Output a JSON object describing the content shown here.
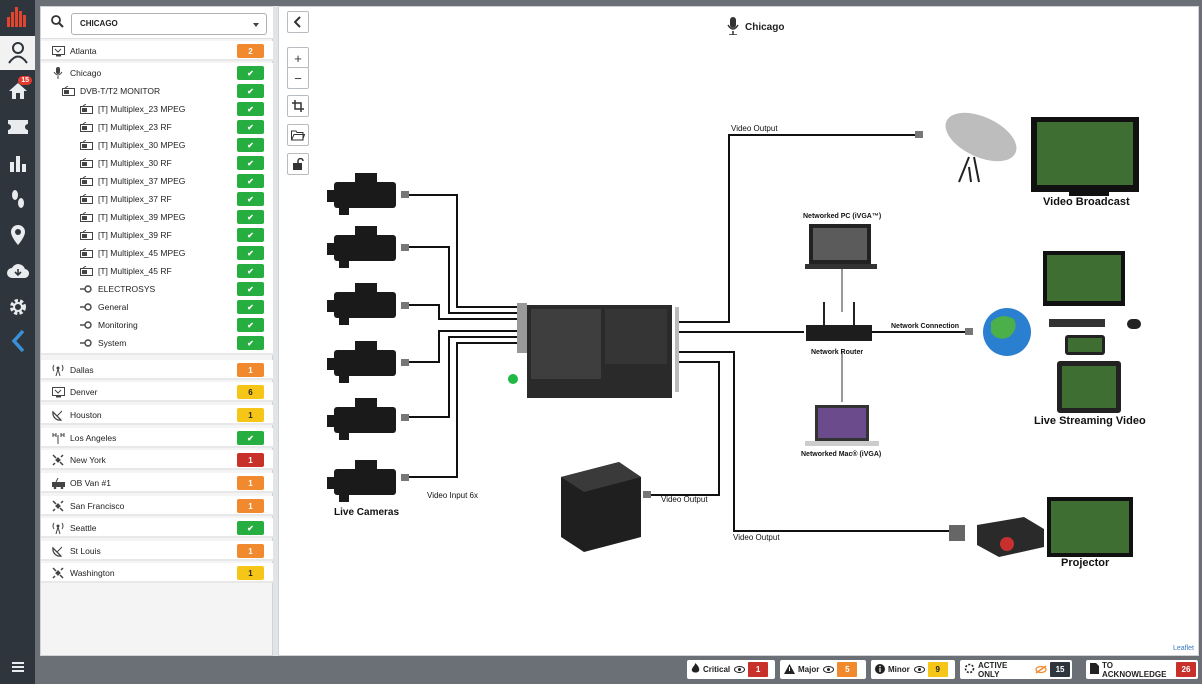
{
  "nav": {
    "home_badge": "15"
  },
  "search": {
    "selected": "CHICAGO"
  },
  "sites": [
    {
      "name": "Atlanta",
      "badge": "2",
      "color": "orange"
    },
    {
      "name": "Chicago",
      "badge": "✔",
      "color": "green"
    },
    {
      "name": "Dallas",
      "badge": "1",
      "color": "orange"
    },
    {
      "name": "Denver",
      "badge": "6",
      "color": "yellow"
    },
    {
      "name": "Houston",
      "badge": "1",
      "color": "yellow"
    },
    {
      "name": "Los Angeles",
      "badge": "✔",
      "color": "green"
    },
    {
      "name": "New York",
      "badge": "1",
      "color": "red"
    },
    {
      "name": "OB Van #1",
      "badge": "1",
      "color": "orange"
    },
    {
      "name": "San Francisco",
      "badge": "1",
      "color": "orange"
    },
    {
      "name": "Seattle",
      "badge": "✔",
      "color": "green"
    },
    {
      "name": "St Louis",
      "badge": "1",
      "color": "orange"
    },
    {
      "name": "Washington",
      "badge": "1",
      "color": "yellow"
    }
  ],
  "chicago_children": [
    {
      "name": "DVB-T/T2 MONITOR",
      "badge": "✔"
    },
    {
      "name": "[T] Multiplex_23 MPEG",
      "badge": "✔"
    },
    {
      "name": "[T] Multiplex_23 RF",
      "badge": "✔"
    },
    {
      "name": "[T] Multiplex_30 MPEG",
      "badge": "✔"
    },
    {
      "name": "[T] Multiplex_30 RF",
      "badge": "✔"
    },
    {
      "name": "[T] Multiplex_37 MPEG",
      "badge": "✔"
    },
    {
      "name": "[T] Multiplex_37 RF",
      "badge": "✔"
    },
    {
      "name": "[T] Multiplex_39 MPEG",
      "badge": "✔"
    },
    {
      "name": "[T] Multiplex_39 RF",
      "badge": "✔"
    },
    {
      "name": "[T] Multiplex_45 MPEG",
      "badge": "✔"
    },
    {
      "name": "[T] Multiplex_45 RF",
      "badge": "✔"
    },
    {
      "name": "ELECTROSYS",
      "badge": "✔"
    },
    {
      "name": "General",
      "badge": "✔"
    },
    {
      "name": "Monitoring",
      "badge": "✔"
    },
    {
      "name": "System",
      "badge": "✔"
    }
  ],
  "map": {
    "title": "Chicago",
    "attribution": "Leaflet",
    "labels": {
      "video_output_top": "Video Output",
      "video_broadcast": "Video Broadcast",
      "networked_pc": "Networked PC (iVGA™)",
      "network_router": "Network Router",
      "network_connection": "Network Connection",
      "live_streaming": "Live Streaming Video",
      "networked_mac": "Networked Mac® (iVGA)",
      "video_input": "Video Input 6x",
      "video_output_mid": "Video Output",
      "video_output_low": "Video Output",
      "live_cameras": "Live Cameras",
      "projector": "Projector"
    }
  },
  "status": {
    "critical_label": "Critical",
    "critical_count": "1",
    "major_label": "Major",
    "major_count": "5",
    "minor_label": "Minor",
    "minor_count": "9",
    "active_label": "ACTIVE ONLY",
    "active_count": "15",
    "ack_label": "TO ACKNOWLEDGE",
    "ack_count": "26"
  },
  "colors": {
    "green": "#27ae40",
    "orange": "#f18a2e",
    "yellow": "#f5c518",
    "red": "#c8312a",
    "sidebar_dark": "#2f353c"
  }
}
